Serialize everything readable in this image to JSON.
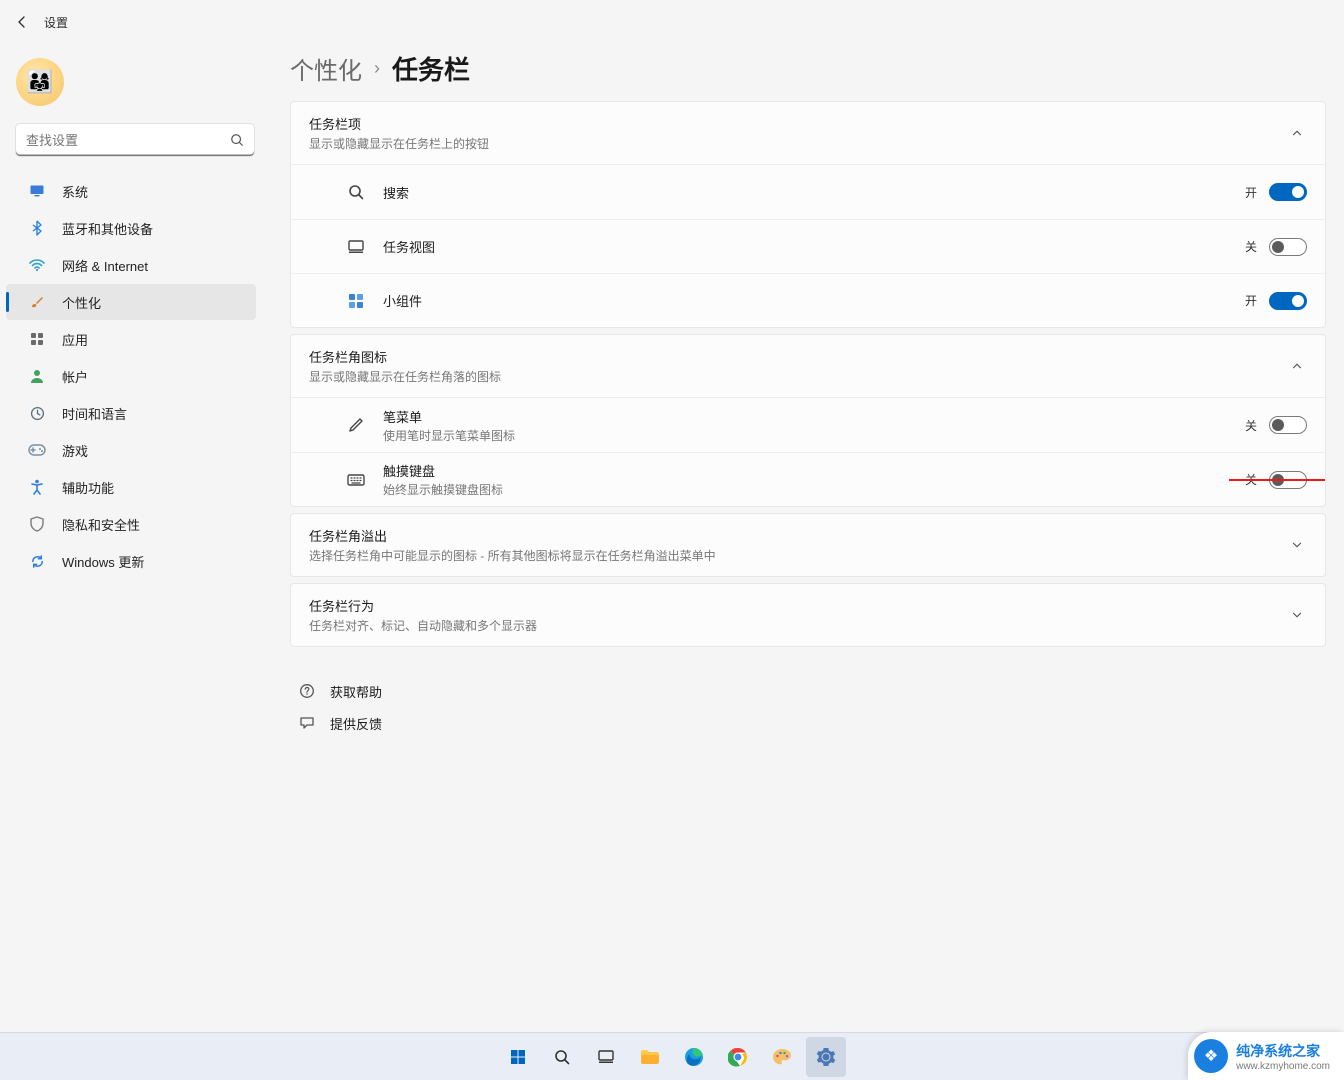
{
  "app_title": "设置",
  "search": {
    "placeholder": "查找设置"
  },
  "nav": {
    "items": [
      {
        "id": "system",
        "label": "系统",
        "icon": "monitor-icon",
        "color": "#3a7ad9"
      },
      {
        "id": "bluetooth",
        "label": "蓝牙和其他设备",
        "icon": "bluetooth-icon",
        "color": "#2f7fe0"
      },
      {
        "id": "network",
        "label": "网络 & Internet",
        "icon": "wifi-icon",
        "color": "#2aa3c9"
      },
      {
        "id": "personalize",
        "label": "个性化",
        "icon": "brush-icon",
        "color": "#d67a2a"
      },
      {
        "id": "apps",
        "label": "应用",
        "icon": "grid-icon",
        "color": "#6a6a6a"
      },
      {
        "id": "accounts",
        "label": "帐户",
        "icon": "person-icon",
        "color": "#43a35b"
      },
      {
        "id": "time",
        "label": "时间和语言",
        "icon": "clock-icon",
        "color": "#5a6f7a"
      },
      {
        "id": "gaming",
        "label": "游戏",
        "icon": "game-icon",
        "color": "#7a8fa0"
      },
      {
        "id": "accessibility",
        "label": "辅助功能",
        "icon": "accessibility-icon",
        "color": "#2f7fe0"
      },
      {
        "id": "privacy",
        "label": "隐私和安全性",
        "icon": "shield-icon",
        "color": "#7a7a7a"
      },
      {
        "id": "update",
        "label": "Windows 更新",
        "icon": "update-icon",
        "color": "#2f7fe0"
      }
    ],
    "active_id": "personalize"
  },
  "breadcrumb": {
    "parent": "个性化",
    "current": "任务栏"
  },
  "state_labels": {
    "on": "开",
    "off": "关"
  },
  "sections": {
    "items": {
      "title": "任务栏项",
      "subtitle": "显示或隐藏显示在任务栏上的按钮",
      "expanded": true,
      "rows": [
        {
          "id": "search",
          "title": "搜索",
          "subtitle": "",
          "icon": "search-icon",
          "on": true
        },
        {
          "id": "taskview",
          "title": "任务视图",
          "subtitle": "",
          "icon": "taskview-icon",
          "on": false
        },
        {
          "id": "widgets",
          "title": "小组件",
          "subtitle": "",
          "icon": "widgets-icon",
          "on": true
        }
      ]
    },
    "corner_icons": {
      "title": "任务栏角图标",
      "subtitle": "显示或隐藏显示在任务栏角落的图标",
      "expanded": true,
      "rows": [
        {
          "id": "pen",
          "title": "笔菜单",
          "subtitle": "使用笔时显示笔菜单图标",
          "icon": "pen-icon",
          "on": false,
          "arrow": false
        },
        {
          "id": "touchkb",
          "title": "触摸键盘",
          "subtitle": "始终显示触摸键盘图标",
          "icon": "keyboard-icon",
          "on": false,
          "arrow": true
        }
      ]
    },
    "overflow": {
      "title": "任务栏角溢出",
      "subtitle": "选择任务栏角中可能显示的图标 - 所有其他图标将显示在任务栏角溢出菜单中",
      "expanded": false
    },
    "behaviors": {
      "title": "任务栏行为",
      "subtitle": "任务栏对齐、标记、自动隐藏和多个显示器",
      "expanded": false
    }
  },
  "help": {
    "get_help": "获取帮助",
    "feedback": "提供反馈"
  },
  "taskbar_apps": [
    {
      "id": "start",
      "icon": "start-icon"
    },
    {
      "id": "search",
      "icon": "search-icon"
    },
    {
      "id": "taskview",
      "icon": "taskview-icon"
    },
    {
      "id": "explorer",
      "icon": "folder-icon"
    },
    {
      "id": "edge",
      "icon": "edge-icon"
    },
    {
      "id": "chrome",
      "icon": "chrome-icon"
    },
    {
      "id": "paint",
      "icon": "palette-icon"
    },
    {
      "id": "settings",
      "icon": "gear-icon",
      "active": true
    }
  ],
  "watermark": {
    "title": "纯净系统之家",
    "url": "www.kzmyhome.com"
  }
}
